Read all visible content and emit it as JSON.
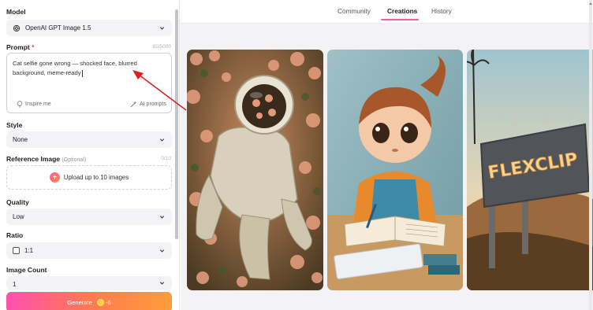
{
  "left": {
    "model": {
      "label": "Model",
      "value": "OpenAI GPT Image 1.5"
    },
    "prompt": {
      "label": "Prompt",
      "required": "*",
      "counter": "65/5000",
      "value": "Cat selfie gone wrong — shocked face, blurred background, meme-ready",
      "inspire": "Inspire me",
      "ai_prompts": "AI prompts"
    },
    "style": {
      "label": "Style",
      "value": "None"
    },
    "reference": {
      "label": "Reference Image",
      "optional": "(Optional)",
      "counter": "0/10",
      "upload": "Upload up to 10 images"
    },
    "quality": {
      "label": "Quality",
      "value": "Low"
    },
    "ratio": {
      "label": "Ratio",
      "value": "1:1"
    },
    "image_count": {
      "label": "Image Count",
      "value": "1"
    },
    "generate": {
      "label": "Generate",
      "cost": "-6"
    }
  },
  "tabs": [
    {
      "label": "Community",
      "active": false
    },
    {
      "label": "Creations",
      "active": true
    },
    {
      "label": "History",
      "active": false
    }
  ],
  "gallery": {
    "billboard_text": "FLEXCLIP"
  },
  "colors": {
    "accent": "#ff5a9a",
    "generate_start": "#ff4fb0",
    "generate_end": "#ff9d3a",
    "annotation": "#e02020"
  }
}
